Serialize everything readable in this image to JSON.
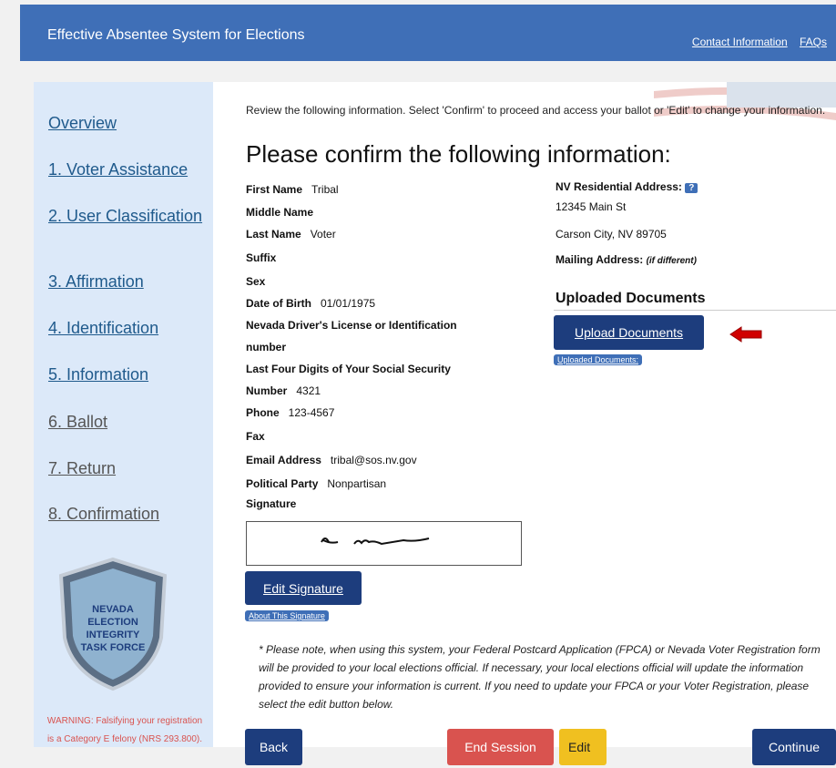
{
  "header": {
    "title": "Effective Absentee System for Elections",
    "contact_link": "Contact Information",
    "faqs_link": "FAQs"
  },
  "sidebar": {
    "items": [
      {
        "label": "Overview"
      },
      {
        "label": "1. Voter Assistance"
      },
      {
        "label": "2. User Classification"
      },
      {
        "label": "3. Affirmation"
      },
      {
        "label": "4. Identification"
      },
      {
        "label": "5. Information"
      },
      {
        "label": "6. Ballot"
      },
      {
        "label": "7. Return"
      },
      {
        "label": "8. Confirmation"
      }
    ],
    "badge_lines": [
      "NEVADA",
      "ELECTION",
      "INTEGRITY",
      "TASK FORCE"
    ],
    "warning": "WARNING: Falsifying your registration is a Category E felony (NRS 293.800)."
  },
  "main": {
    "intro": "Review the following information. Select 'Confirm' to proceed and access your ballot or 'Edit' to change your information.",
    "heading": "Please confirm the following information:",
    "fields": {
      "first_name_label": "First Name",
      "first_name": "Tribal",
      "middle_name_label": "Middle Name",
      "last_name_label": "Last Name",
      "last_name": "Voter",
      "suffix_label": "Suffix",
      "sex_label": "Sex",
      "dob_label": "Date of Birth",
      "dob": "01/01/1975",
      "license_label_1": "Nevada Driver's License or Identification",
      "license_label_2": "number",
      "ssn_label_1": "Last Four Digits of Your Social Security",
      "ssn_label_2": "Number",
      "ssn": "4321",
      "phone_label": "Phone",
      "phone": "123-4567",
      "fax_label": "Fax",
      "email_label": "Email Address",
      "email": "tribal@sos.nv.gov",
      "party_label": "Political Party",
      "party": "Nonpartisan",
      "signature_label": "Signature"
    },
    "address": {
      "residential_label": "NV Residential Address:",
      "help": "?",
      "line1": "12345 Main St",
      "line2": "Carson City, NV 89705",
      "mailing_label": "Mailing Address:",
      "mailing_note": "(if different)"
    },
    "documents": {
      "heading": "Uploaded Documents",
      "upload_button": "Upload Documents",
      "uploaded_link": "Uploaded Documents:"
    },
    "edit_signature": "Edit Signature",
    "about_signature": "About This Signature",
    "note": "* Please note, when using this system, your Federal Postcard Application (FPCA) or Nevada Voter Registration form will be provided to your local elections official. If necessary, your local elections official will update the information provided to ensure your information is current. If you need to update your FPCA or your Voter Registration, please select the edit button below.",
    "buttons": {
      "back": "Back",
      "end_session": "End Session",
      "edit": "Edit",
      "continue": "Continue"
    }
  },
  "colors": {
    "header": "#3f6fb7",
    "navy_button": "#1d3d7d",
    "end_session": "#d9534f",
    "edit": "#f0c020",
    "sidebar": "#dce9f9"
  }
}
